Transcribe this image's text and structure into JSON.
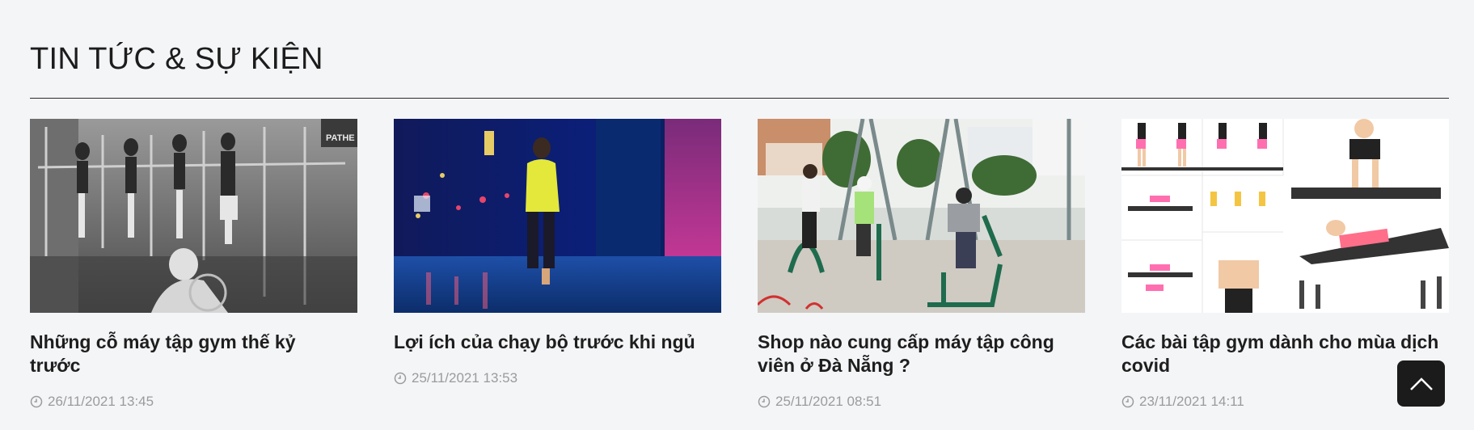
{
  "section": {
    "title": "TIN TỨC & SỰ KIỆN"
  },
  "articles": [
    {
      "image_icon": "vintage-gym-photo",
      "image_caption": "PATHE",
      "title": "Những cỗ máy tập gym thế kỷ trước",
      "date": "26/11/2021 13:45"
    },
    {
      "image_icon": "night-runner-photo",
      "title": "Lợi ích của chạy bộ trước khi ngủ",
      "date": "25/11/2021 13:53"
    },
    {
      "image_icon": "outdoor-gym-photo",
      "title": "Shop nào cung cấp máy tập công viên ở Đà Nẵng ?",
      "date": "25/11/2021 08:51"
    },
    {
      "image_icon": "exercise-grid-photo",
      "title": "Các bài tập gym dành cho mùa dịch covid",
      "date": "23/11/2021 14:11"
    }
  ],
  "back_to_top": {
    "icon": "chevron-up-icon"
  },
  "colors": {
    "background": "#f4f5f7",
    "title_text": "#1c1c1c",
    "meta_text": "#9b9b9b",
    "back_to_top_bg": "#1b1b1b"
  }
}
